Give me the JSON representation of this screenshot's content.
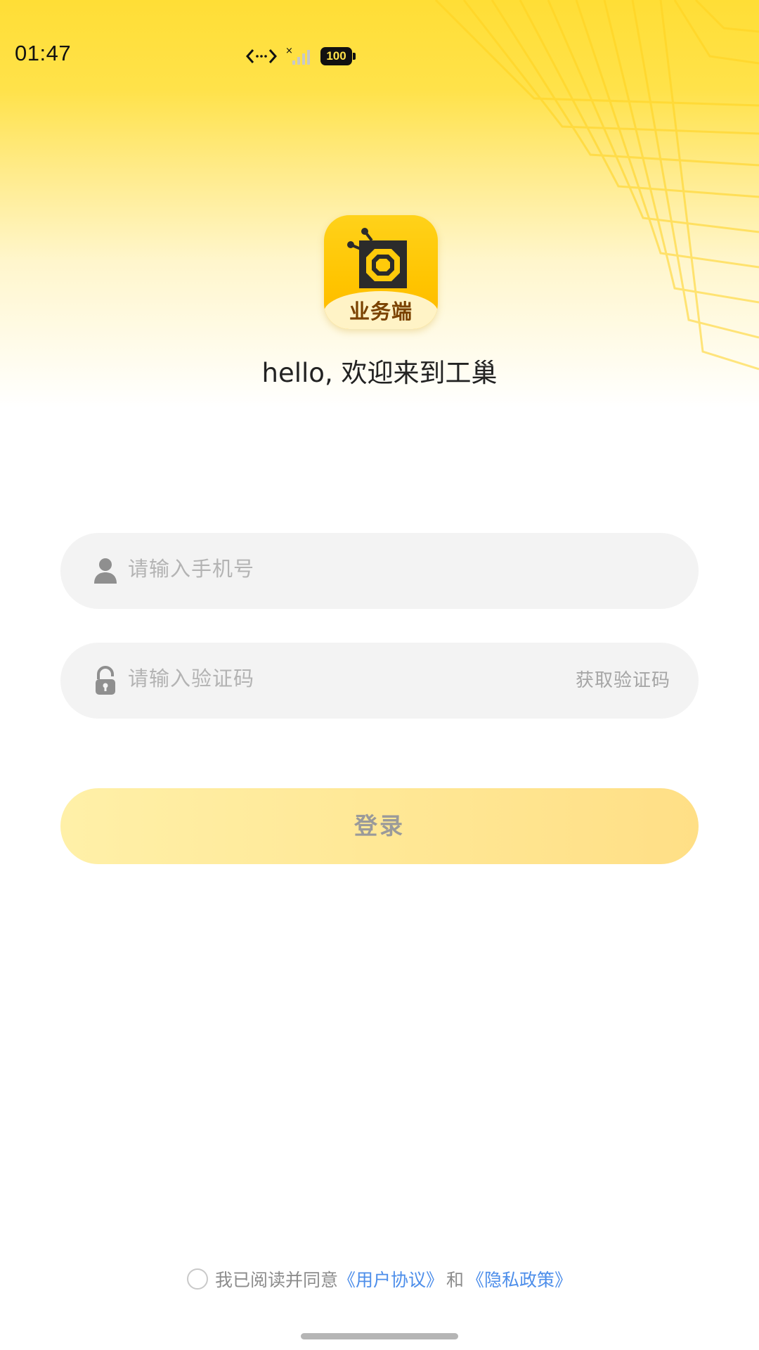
{
  "status_bar": {
    "time": "01:47",
    "battery": "100",
    "icons": [
      "data-transfer-icon",
      "signal-no-service-icon",
      "battery-icon"
    ]
  },
  "app": {
    "icon_label": "业务端",
    "welcome": "hello, 欢迎来到工巢",
    "brand_color": "#ffcc00"
  },
  "form": {
    "phone_placeholder": "请输入手机号",
    "code_placeholder": "请输入验证码",
    "get_code_label": "获取验证码",
    "login_label": "登录"
  },
  "agreement": {
    "prefix": "我已阅读并同意",
    "user_agreement": "《用户协议》",
    "conjunction": "和",
    "privacy_policy": "《隐私政策》",
    "link_color": "#4d8eea"
  }
}
